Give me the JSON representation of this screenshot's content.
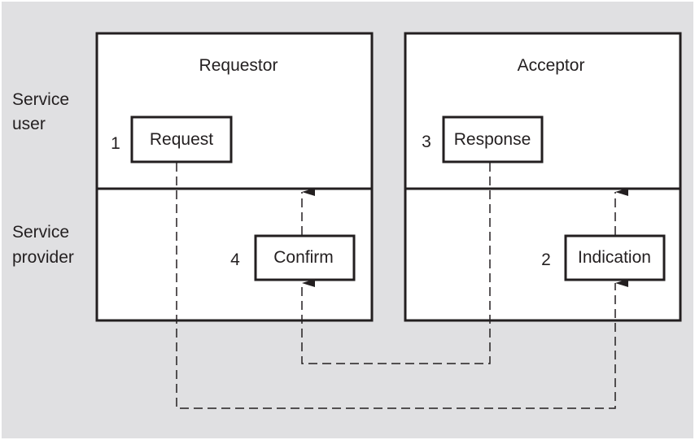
{
  "diagram": {
    "colors": {
      "background": "#e0e0e2",
      "box_fill": "#ffffff",
      "stroke": "#231f20",
      "text": "#231f20"
    },
    "row_labels": {
      "service_user": [
        "Service",
        "user"
      ],
      "service_provider": [
        "Service",
        "provider"
      ]
    },
    "entities": [
      {
        "id": "requestor",
        "title": "Requestor"
      },
      {
        "id": "acceptor",
        "title": "Acceptor"
      }
    ],
    "primitives": [
      {
        "id": "request",
        "label": "Request",
        "step": "1",
        "entity": "requestor",
        "layer": "Service user"
      },
      {
        "id": "indication",
        "label": "Indication",
        "step": "2",
        "entity": "acceptor",
        "layer": "Service provider"
      },
      {
        "id": "response",
        "label": "Response",
        "step": "3",
        "entity": "acceptor",
        "layer": "Service user"
      },
      {
        "id": "confirm",
        "label": "Confirm",
        "step": "4",
        "entity": "requestor",
        "layer": "Service provider"
      }
    ],
    "flows": [
      {
        "from": "request",
        "to": "indication",
        "style": "dashed"
      },
      {
        "from": "indication",
        "to": "acceptor-service-user",
        "style": "dashed"
      },
      {
        "from": "response",
        "to": "confirm",
        "style": "dashed"
      },
      {
        "from": "confirm",
        "to": "requestor-service-user",
        "style": "dashed"
      }
    ]
  }
}
